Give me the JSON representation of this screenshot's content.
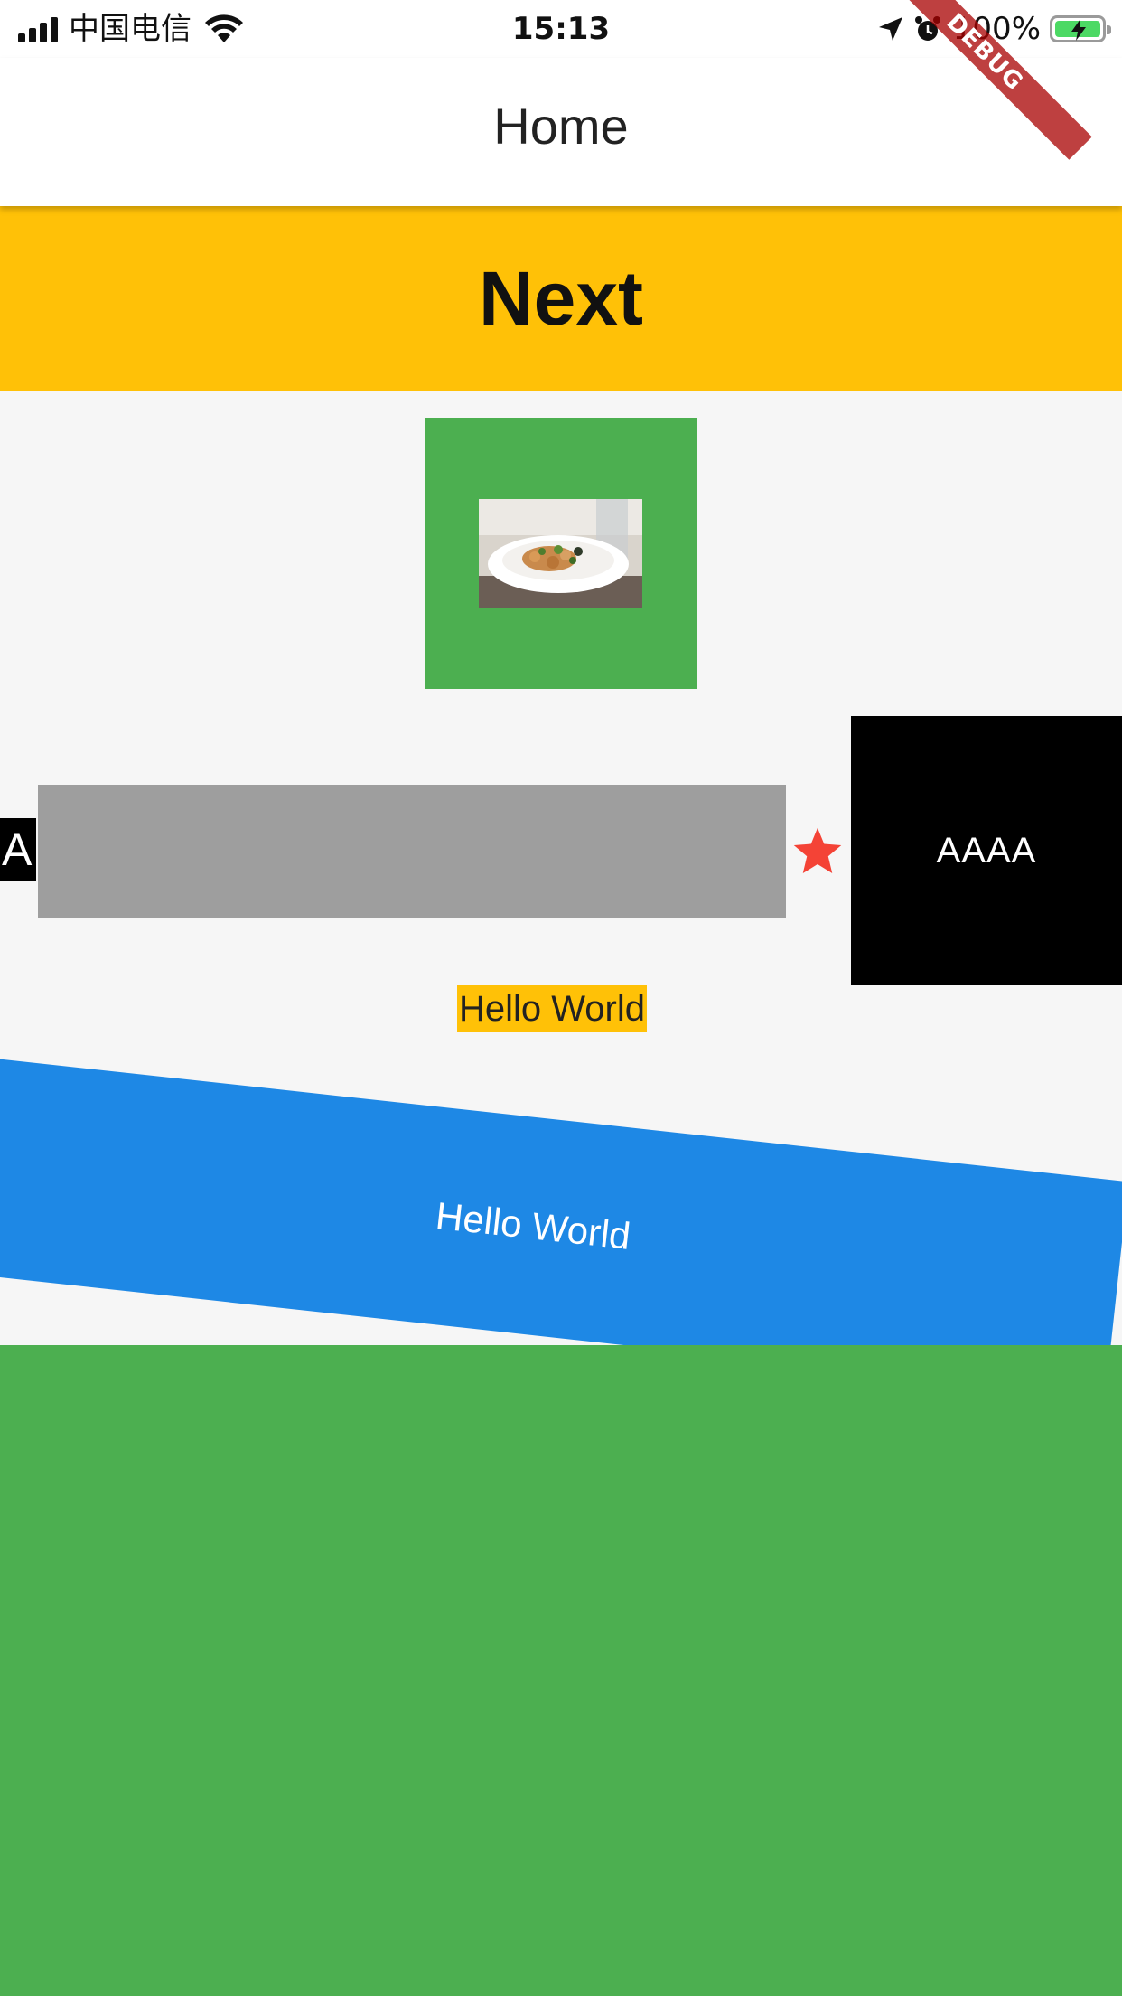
{
  "status_bar": {
    "carrier": "中国电信",
    "time": "15:13",
    "battery_percent": "100%",
    "icons": [
      "signal-icon",
      "wifi-icon",
      "location-icon",
      "alarm-icon",
      "battery-icon"
    ]
  },
  "app_bar": {
    "title": "Home"
  },
  "debug_banner": {
    "label": "DEBUG"
  },
  "next_button": {
    "label": "Next"
  },
  "image_box": {
    "image_alt": "food-photo"
  },
  "row": {
    "a_label": "A",
    "black_box_label": "AAAA",
    "star": "star-icon"
  },
  "hello_highlight": {
    "text": "Hello World"
  },
  "blue_box": {
    "text": "Hello World"
  },
  "colors": {
    "accent_yellow": "#ffc107",
    "green": "#4caf50",
    "blue": "#1e88e5",
    "gray": "#9e9e9e",
    "star_red": "#f44336"
  }
}
